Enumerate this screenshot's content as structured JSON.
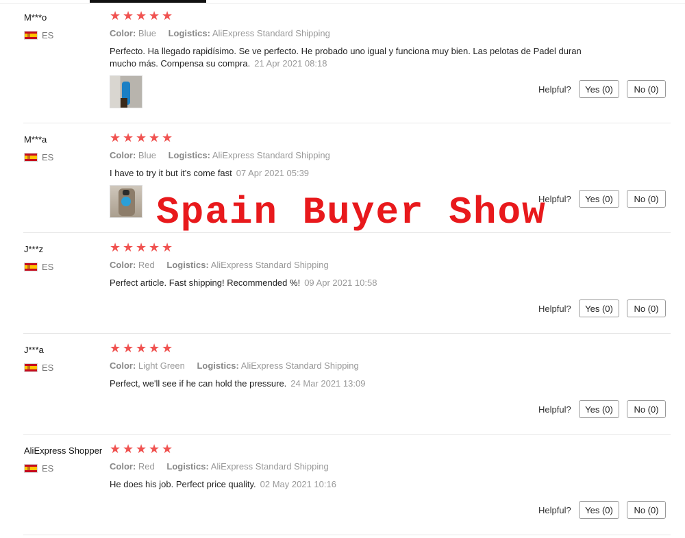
{
  "helpful_label": "Helpful?",
  "labels": {
    "color": "Color:",
    "logistics": "Logistics:"
  },
  "colors": {
    "star": "#f05250",
    "watermark": "#e8191c",
    "flag_red": "#c60b1e",
    "flag_yellow": "#ffc400"
  },
  "watermark_text": "Spain Buyer Show",
  "reviews": [
    {
      "user": "M***o",
      "country": "ES",
      "rating": 5,
      "color": "Blue",
      "logistics": "AliExpress Standard Shipping",
      "content_line1": "Perfecto. Ha llegado rapidísimo. Se ve perfecto. He probado uno igual y funciona muy bien. Las pelotas de Padel duran",
      "content_line2": "mucho más. Compensa su compra.",
      "time": "21 Apr 2021 08:18",
      "yes": "Yes (0)",
      "no": "No (0)"
    },
    {
      "user": "M***a",
      "country": "ES",
      "rating": 5,
      "color": "Blue",
      "logistics": "AliExpress Standard Shipping",
      "content": "I have to try it but it's come fast",
      "time": "07 Apr 2021 05:39",
      "yes": "Yes (0)",
      "no": "No (0)"
    },
    {
      "user": "J***z",
      "country": "ES",
      "rating": 5,
      "color": "Red",
      "logistics": "AliExpress Standard Shipping",
      "content": "Perfect article. Fast shipping! Recommended %!",
      "time": "09 Apr 2021 10:58",
      "yes": "Yes (0)",
      "no": "No (0)"
    },
    {
      "user": "J***a",
      "country": "ES",
      "rating": 5,
      "color": "Light Green",
      "logistics": "AliExpress Standard Shipping",
      "content": "Perfect, we'll see if he can hold the pressure.",
      "time": "24 Mar 2021 13:09",
      "yes": "Yes (0)",
      "no": "No (0)"
    },
    {
      "user": "AliExpress Shopper",
      "country": "ES",
      "rating": 5,
      "color": "Red",
      "logistics": "AliExpress Standard Shipping",
      "content": "He does his job. Perfect price quality.",
      "time": "02 May 2021 10:16",
      "yes": "Yes (0)",
      "no": "No (0)"
    }
  ]
}
